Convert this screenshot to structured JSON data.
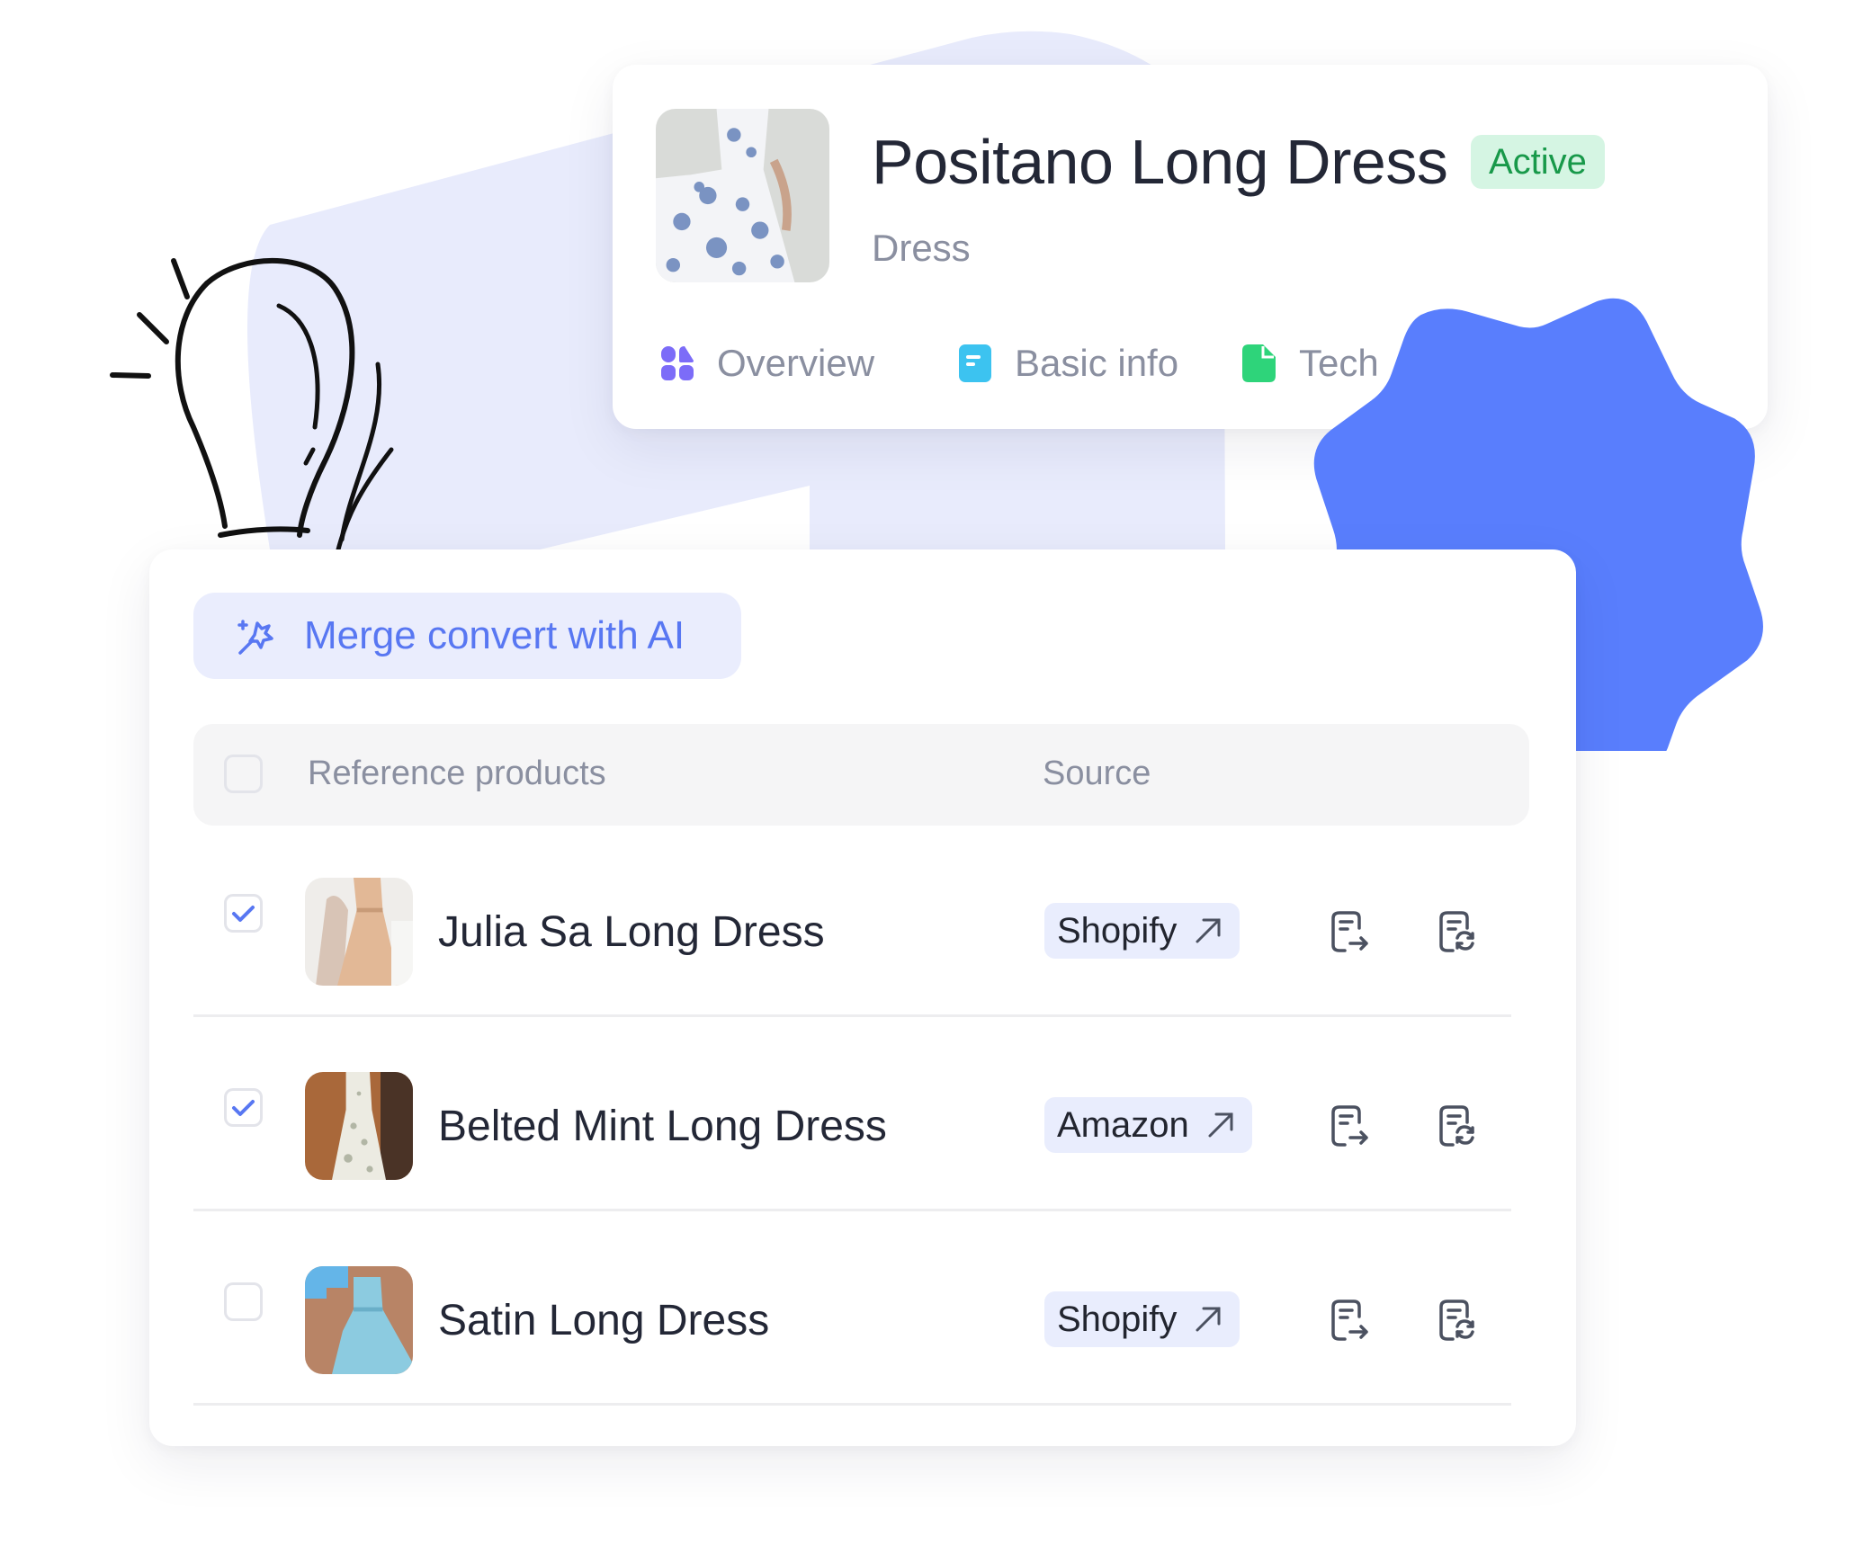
{
  "colors": {
    "accent": "#5877F2",
    "blob": "#597EFD",
    "lavender": "#E8EBFC",
    "status_active_bg": "#D5F5E3",
    "status_active_text": "#18994A",
    "tab_overview": "#7C6CF8",
    "tab_basic_info": "#3CC3F0",
    "tab_tech": "#2ED47A"
  },
  "product": {
    "title": "Positano Long Dress",
    "status": "Active",
    "category": "Dress",
    "image": "blue-floral-halter-dress-photo"
  },
  "tabs": [
    {
      "label": "Overview",
      "icon": "grid-icon"
    },
    {
      "label": "Basic info",
      "icon": "document-icon"
    },
    {
      "label": "Tech",
      "icon": "file-icon"
    }
  ],
  "merge_button": {
    "label": "Merge convert with AI",
    "icon": "magic-wand-icon"
  },
  "table": {
    "columns": [
      "Reference products",
      "Source"
    ],
    "header_checked": false,
    "rows": [
      {
        "name": "Julia Sa Long Dress",
        "source": "Shopify",
        "checked": true,
        "image": "beige-satin-dress-photo"
      },
      {
        "name": "Belted Mint Long Dress",
        "source": "Amazon",
        "checked": true,
        "image": "white-floral-dress-photo"
      },
      {
        "name": "Satin Long Dress",
        "source": "Shopify",
        "checked": false,
        "image": "light-blue-dress-photo"
      }
    ],
    "row_actions": [
      "export-document-icon",
      "sync-document-icon"
    ]
  }
}
